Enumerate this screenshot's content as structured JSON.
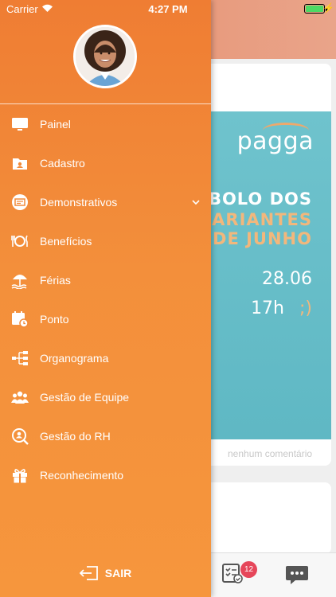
{
  "status_bar": {
    "carrier": "Carrier",
    "time": "4:27 PM",
    "battery_color": "#4cd964"
  },
  "drawer": {
    "gradient_top": "#ef7d33",
    "gradient_bottom": "#f6963d",
    "menu": [
      {
        "label": "Painel",
        "icon": "monitor-icon"
      },
      {
        "label": "Cadastro",
        "icon": "folder-icon"
      },
      {
        "label": "Demonstrativos",
        "icon": "statement-icon",
        "expandable": true
      },
      {
        "label": "Benefícios",
        "icon": "cutlery-icon"
      },
      {
        "label": "Férias",
        "icon": "beach-umbrella-icon"
      },
      {
        "label": "Ponto",
        "icon": "calendar-clock-icon"
      },
      {
        "label": "Organograma",
        "icon": "org-chart-icon"
      },
      {
        "label": "Gestão de Equipe",
        "icon": "team-icon"
      },
      {
        "label": "Gestão do RH",
        "icon": "hr-search-icon"
      },
      {
        "label": "Reconhecimento",
        "icon": "gift-icon"
      }
    ],
    "logout_label": "SAIR"
  },
  "background": {
    "banner": {
      "logo": "pagga",
      "line1": "BOLO DOS",
      "line2": "SARIANTES",
      "line3": "DE JUNHO",
      "date": "28.06",
      "time": "17h",
      "smile": ";)"
    },
    "no_comment": "nenhum comentário",
    "tab_badge_count": "12"
  }
}
